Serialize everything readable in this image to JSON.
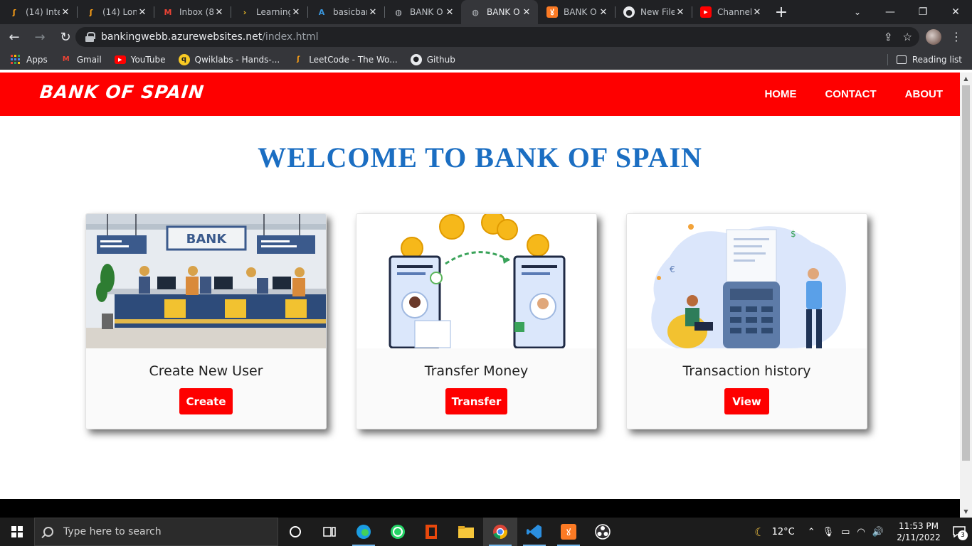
{
  "browser": {
    "tabs": [
      {
        "title": "(14) Inte",
        "icon": "leetcode-icon",
        "active": false
      },
      {
        "title": "(14) Lon",
        "icon": "leetcode-icon",
        "active": false
      },
      {
        "title": "Inbox (8",
        "icon": "gmail-icon",
        "active": false
      },
      {
        "title": "Learning",
        "icon": "learning-icon",
        "active": false
      },
      {
        "title": "basicbar",
        "icon": "azure-icon",
        "active": false
      },
      {
        "title": "BANK O",
        "icon": "globe-icon",
        "active": false
      },
      {
        "title": "BANK O",
        "icon": "globe-icon",
        "active": true
      },
      {
        "title": "BANK O",
        "icon": "xampp-icon",
        "active": false
      },
      {
        "title": "New File",
        "icon": "github-icon",
        "active": false
      },
      {
        "title": "Channel",
        "icon": "youtube-icon",
        "active": false
      }
    ],
    "url_host": "bankingwebb.azurewebsites.net",
    "url_path": "/index.html",
    "bookmarks": [
      {
        "label": "Apps",
        "icon": "apps-grid-icon"
      },
      {
        "label": "Gmail",
        "icon": "gmail-icon"
      },
      {
        "label": "YouTube",
        "icon": "youtube-icon"
      },
      {
        "label": "Qwiklabs - Hands-...",
        "icon": "qwiklabs-icon"
      },
      {
        "label": "LeetCode - The Wo...",
        "icon": "leetcode-icon"
      },
      {
        "label": "Github",
        "icon": "github-icon"
      }
    ],
    "reading_list": "Reading list"
  },
  "site": {
    "brand": "BANK OF SPAIN",
    "nav": [
      "HOME",
      "CONTACT",
      "ABOUT"
    ],
    "welcome": "WELCOME TO BANK OF SPAIN",
    "accent_color": "#fe0000",
    "heading_color": "#1b6ec2",
    "cards": [
      {
        "title": "Create New User",
        "button": "Create",
        "sign": "BANK"
      },
      {
        "title": "Transfer Money",
        "button": "Transfer"
      },
      {
        "title": "Transaction history",
        "button": "View"
      }
    ]
  },
  "taskbar": {
    "search_placeholder": "Type here to search",
    "weather": "12°C",
    "time": "11:53 PM",
    "date": "2/11/2022",
    "notifications": "3"
  }
}
